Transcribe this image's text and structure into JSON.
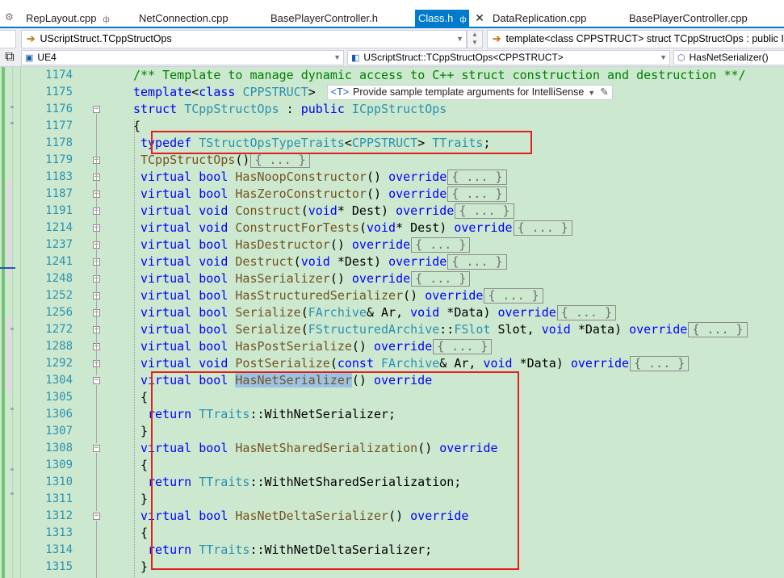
{
  "tabs": [
    {
      "label": "RepLayout.cpp",
      "pinned": true,
      "active": false
    },
    {
      "label": "NetConnection.cpp",
      "active": false
    },
    {
      "label": "BasePlayerController.h",
      "active": false
    },
    {
      "label": "Class.h",
      "pinned": true,
      "active": true
    },
    {
      "label": "DataReplication.cpp",
      "active": false
    },
    {
      "label": "BasePlayerController.cpp",
      "active": false
    }
  ],
  "tab_icons": {
    "settings": "gear-icon",
    "pin": "pin-icon",
    "close": "close-icon"
  },
  "navigation": {
    "left_combo": "UScriptStruct.TCppStructOps",
    "right_combo": "template<class CPPSTRUCT> struct TCppStructOps : public ICppStructOps"
  },
  "scope": {
    "project": "UE4",
    "type": "UScriptStruct::TCppStructOps<CPPSTRUCT>",
    "member": "HasNetSerializer()"
  },
  "colors": {
    "accent": "#007acc",
    "editor_bg": "#cce8cf",
    "keyword": "#0000ff",
    "type": "#2b91af",
    "function": "#74531f",
    "comment": "#008000",
    "highlight_box": "#e02020"
  },
  "inline_hint": {
    "tag": "<T>",
    "text": "Provide sample template arguments for IntelliSense"
  },
  "collapsed_text": "{ ... }",
  "editor_lines": [
    {
      "num": "1174",
      "fold": ""
    },
    {
      "num": "1175",
      "fold": ""
    },
    {
      "num": "1176",
      "fold": "minus"
    },
    {
      "num": "1177",
      "fold": ""
    },
    {
      "num": "1178",
      "fold": ""
    },
    {
      "num": "1179",
      "fold": "plus"
    },
    {
      "num": "1183",
      "fold": "plus"
    },
    {
      "num": "1187",
      "fold": "plus"
    },
    {
      "num": "1191",
      "fold": "plus"
    },
    {
      "num": "1214",
      "fold": "plus"
    },
    {
      "num": "1237",
      "fold": "plus"
    },
    {
      "num": "1241",
      "fold": "plus"
    },
    {
      "num": "1248",
      "fold": "plus"
    },
    {
      "num": "1252",
      "fold": "plus"
    },
    {
      "num": "1256",
      "fold": "plus"
    },
    {
      "num": "1272",
      "fold": "plus"
    },
    {
      "num": "1288",
      "fold": "plus"
    },
    {
      "num": "1292",
      "fold": "plus"
    },
    {
      "num": "1304",
      "fold": "minus"
    },
    {
      "num": "1305",
      "fold": ""
    },
    {
      "num": "1306",
      "fold": ""
    },
    {
      "num": "1307",
      "fold": ""
    },
    {
      "num": "1308",
      "fold": "minus"
    },
    {
      "num": "1309",
      "fold": ""
    },
    {
      "num": "1310",
      "fold": ""
    },
    {
      "num": "1311",
      "fold": ""
    },
    {
      "num": "1312",
      "fold": "minus"
    },
    {
      "num": "1313",
      "fold": ""
    },
    {
      "num": "1314",
      "fold": ""
    },
    {
      "num": "1315",
      "fold": ""
    }
  ],
  "code_lines": [
    [
      [
        "cm",
        "/** Template to manage dynamic access to C++ struct construction and destruction **/"
      ]
    ],
    [
      [
        "kw",
        "template"
      ],
      [
        "",
        "<"
      ],
      [
        "kw",
        "class"
      ],
      [
        "",
        ""
      ],
      [
        "ty",
        " CPPSTRUCT"
      ],
      [
        "",
        ">"
      ],
      [
        "hint",
        ""
      ]
    ],
    [
      [
        "kw",
        "struct"
      ],
      [
        "cls",
        " TCppStructOps"
      ],
      [
        "",
        " : "
      ],
      [
        "kw",
        "public"
      ],
      [
        "cls",
        " ICppStructOps"
      ]
    ],
    [
      [
        "",
        "{"
      ]
    ],
    [
      [
        "kw",
        "typedef"
      ],
      [
        "cls",
        " TStructOpsTypeTraits"
      ],
      [
        "",
        "<"
      ],
      [
        "ty",
        "CPPSTRUCT"
      ],
      [
        "",
        "> "
      ],
      [
        "cls",
        "TTraits"
      ],
      [
        "",
        ";"
      ]
    ],
    [
      [
        "fn",
        "TCppStructOps"
      ],
      [
        "",
        "()"
      ],
      [
        "col",
        ""
      ]
    ],
    [
      [
        "kw",
        "virtual"
      ],
      [
        "",
        " "
      ],
      [
        "kw",
        "bool"
      ],
      [
        "",
        " "
      ],
      [
        "fn",
        "HasNoopConstructor"
      ],
      [
        "",
        "() "
      ],
      [
        "kw",
        "override"
      ],
      [
        "col",
        ""
      ]
    ],
    [
      [
        "kw",
        "virtual"
      ],
      [
        "",
        " "
      ],
      [
        "kw",
        "bool"
      ],
      [
        "",
        " "
      ],
      [
        "fn",
        "HasZeroConstructor"
      ],
      [
        "",
        "() "
      ],
      [
        "kw",
        "override"
      ],
      [
        "col",
        ""
      ]
    ],
    [
      [
        "kw",
        "virtual"
      ],
      [
        "",
        " "
      ],
      [
        "kw",
        "void"
      ],
      [
        "",
        " "
      ],
      [
        "fn",
        "Construct"
      ],
      [
        "",
        "("
      ],
      [
        "kw",
        "void"
      ],
      [
        "",
        "* Dest) "
      ],
      [
        "kw",
        "override"
      ],
      [
        "col",
        ""
      ]
    ],
    [
      [
        "kw",
        "virtual"
      ],
      [
        "",
        " "
      ],
      [
        "kw",
        "void"
      ],
      [
        "",
        " "
      ],
      [
        "fn",
        "ConstructForTests"
      ],
      [
        "",
        "("
      ],
      [
        "kw",
        "void"
      ],
      [
        "",
        "* Dest) "
      ],
      [
        "kw",
        "override"
      ],
      [
        "col",
        ""
      ]
    ],
    [
      [
        "kw",
        "virtual"
      ],
      [
        "",
        " "
      ],
      [
        "kw",
        "bool"
      ],
      [
        "",
        " "
      ],
      [
        "fn",
        "HasDestructor"
      ],
      [
        "",
        "() "
      ],
      [
        "kw",
        "override"
      ],
      [
        "col",
        ""
      ]
    ],
    [
      [
        "kw",
        "virtual"
      ],
      [
        "",
        " "
      ],
      [
        "kw",
        "void"
      ],
      [
        "",
        " "
      ],
      [
        "fn",
        "Destruct"
      ],
      [
        "",
        "("
      ],
      [
        "kw",
        "void"
      ],
      [
        "",
        " *Dest) "
      ],
      [
        "kw",
        "override"
      ],
      [
        "col",
        ""
      ]
    ],
    [
      [
        "kw",
        "virtual"
      ],
      [
        "",
        " "
      ],
      [
        "kw",
        "bool"
      ],
      [
        "",
        " "
      ],
      [
        "fn",
        "HasSerializer"
      ],
      [
        "",
        "() "
      ],
      [
        "kw",
        "override"
      ],
      [
        "col",
        ""
      ]
    ],
    [
      [
        "kw",
        "virtual"
      ],
      [
        "",
        " "
      ],
      [
        "kw",
        "bool"
      ],
      [
        "",
        " "
      ],
      [
        "fn",
        "HasStructuredSerializer"
      ],
      [
        "",
        "() "
      ],
      [
        "kw",
        "override"
      ],
      [
        "col",
        ""
      ]
    ],
    [
      [
        "kw",
        "virtual"
      ],
      [
        "",
        " "
      ],
      [
        "kw",
        "bool"
      ],
      [
        "",
        " "
      ],
      [
        "fn",
        "Serialize"
      ],
      [
        "",
        "("
      ],
      [
        "cls",
        "FArchive"
      ],
      [
        "",
        "& Ar, "
      ],
      [
        "kw",
        "void"
      ],
      [
        "",
        " *Data) "
      ],
      [
        "kw",
        "override"
      ],
      [
        "col",
        ""
      ]
    ],
    [
      [
        "kw",
        "virtual"
      ],
      [
        "",
        " "
      ],
      [
        "kw",
        "bool"
      ],
      [
        "",
        " "
      ],
      [
        "fn",
        "Serialize"
      ],
      [
        "",
        "("
      ],
      [
        "cls",
        "FStructuredArchive"
      ],
      [
        "",
        "::"
      ],
      [
        "cls",
        "FSlot"
      ],
      [
        "",
        " Slot, "
      ],
      [
        "kw",
        "void"
      ],
      [
        "",
        " *Data) "
      ],
      [
        "kw",
        "override"
      ],
      [
        "col",
        ""
      ]
    ],
    [
      [
        "kw",
        "virtual"
      ],
      [
        "",
        " "
      ],
      [
        "kw",
        "bool"
      ],
      [
        "",
        " "
      ],
      [
        "fn",
        "HasPostSerialize"
      ],
      [
        "",
        "() "
      ],
      [
        "kw",
        "override"
      ],
      [
        "col",
        ""
      ]
    ],
    [
      [
        "kw",
        "virtual"
      ],
      [
        "",
        " "
      ],
      [
        "kw",
        "void"
      ],
      [
        "",
        " "
      ],
      [
        "fn",
        "PostSerialize"
      ],
      [
        "",
        "("
      ],
      [
        "kw",
        "const"
      ],
      [
        "",
        " "
      ],
      [
        "cls",
        "FArchive"
      ],
      [
        "",
        "& Ar, "
      ],
      [
        "kw",
        "void"
      ],
      [
        "",
        " *Data) "
      ],
      [
        "kw",
        "override"
      ],
      [
        "col",
        ""
      ]
    ],
    [
      [
        "kw",
        "virtual"
      ],
      [
        "",
        " "
      ],
      [
        "kw",
        "bool"
      ],
      [
        "",
        " "
      ],
      [
        "fnhl",
        "HasNetSerializer"
      ],
      [
        "",
        "() "
      ],
      [
        "kw",
        "override"
      ]
    ],
    [
      [
        "",
        "{"
      ]
    ],
    [
      [
        "kw",
        "return"
      ],
      [
        "",
        " "
      ],
      [
        "cls",
        "TTraits"
      ],
      [
        "",
        "::"
      ],
      [
        "",
        "WithNetSerializer;"
      ]
    ],
    [
      [
        "",
        "}"
      ]
    ],
    [
      [
        "kw",
        "virtual"
      ],
      [
        "",
        " "
      ],
      [
        "kw",
        "bool"
      ],
      [
        "",
        " "
      ],
      [
        "fn",
        "HasNetSharedSerialization"
      ],
      [
        "",
        "() "
      ],
      [
        "kw",
        "override"
      ]
    ],
    [
      [
        "",
        "{"
      ]
    ],
    [
      [
        "kw",
        "return"
      ],
      [
        "",
        " "
      ],
      [
        "cls",
        "TTraits"
      ],
      [
        "",
        "::"
      ],
      [
        "",
        "WithNetSharedSerialization;"
      ]
    ],
    [
      [
        "",
        "}"
      ]
    ],
    [
      [
        "kw",
        "virtual"
      ],
      [
        "",
        " "
      ],
      [
        "kw",
        "bool"
      ],
      [
        "",
        " "
      ],
      [
        "fn",
        "HasNetDeltaSerializer"
      ],
      [
        "",
        "() "
      ],
      [
        "kw",
        "override"
      ]
    ],
    [
      [
        "",
        "{"
      ]
    ],
    [
      [
        "kw",
        "return"
      ],
      [
        "",
        " "
      ],
      [
        "cls",
        "TTraits"
      ],
      [
        "",
        "::"
      ],
      [
        "",
        "WithNetDeltaSerializer;"
      ]
    ],
    [
      [
        "",
        "}"
      ]
    ]
  ],
  "code_indents": [
    5,
    5,
    5,
    5,
    7,
    7,
    7,
    7,
    7,
    7,
    7,
    7,
    7,
    7,
    7,
    7,
    7,
    7,
    7,
    7,
    9,
    7,
    7,
    7,
    9,
    7,
    7,
    7,
    9,
    7
  ]
}
